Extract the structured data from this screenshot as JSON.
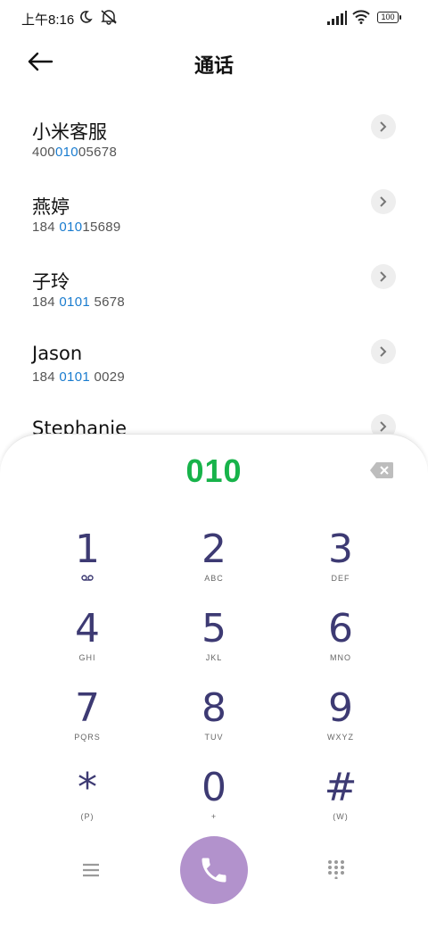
{
  "status_bar": {
    "time": "上午8:16",
    "battery": "100"
  },
  "header": {
    "title": "通话"
  },
  "contacts": [
    {
      "name": "小米客服",
      "number_pre": "400",
      "number_match": "010",
      "number_post": "05678"
    },
    {
      "name": "燕婷",
      "number_pre": "184 ",
      "number_match": "010",
      "number_post": "15689"
    },
    {
      "name": "子玲",
      "number_pre": "184 ",
      "number_match": "0101",
      "number_post": " 5678"
    },
    {
      "name": "Jason",
      "number_pre": "184 ",
      "number_match": "0101",
      "number_post": " 0029"
    },
    {
      "name": "Stephanie",
      "number_pre": "",
      "number_match": "",
      "number_post": ""
    }
  ],
  "dialpad": {
    "display": "010",
    "keys": [
      {
        "digit": "1",
        "letters": ""
      },
      {
        "digit": "2",
        "letters": "ABC"
      },
      {
        "digit": "3",
        "letters": "DEF"
      },
      {
        "digit": "4",
        "letters": "GHI"
      },
      {
        "digit": "5",
        "letters": "JKL"
      },
      {
        "digit": "6",
        "letters": "MNO"
      },
      {
        "digit": "7",
        "letters": "PQRS"
      },
      {
        "digit": "8",
        "letters": "TUV"
      },
      {
        "digit": "9",
        "letters": "WXYZ"
      },
      {
        "digit": "*",
        "letters": "(P)"
      },
      {
        "digit": "0",
        "letters": "+"
      },
      {
        "digit": "#",
        "letters": "(W)"
      }
    ]
  },
  "icons": {
    "moon": "moon-icon",
    "mute": "mute-icon",
    "signal": "signal-icon",
    "wifi": "wifi-icon",
    "back": "back-arrow-icon",
    "chevron": "chevron-right-icon",
    "delete": "backspace-icon",
    "voicemail": "voicemail-icon",
    "menu": "menu-icon",
    "call": "phone-icon",
    "dialpad": "dialpad-icon"
  },
  "colors": {
    "match_highlight": "#1a7ccf",
    "dial_display": "#17b34a",
    "call_button": "#b292cc",
    "key_digit": "#3d3a73"
  }
}
